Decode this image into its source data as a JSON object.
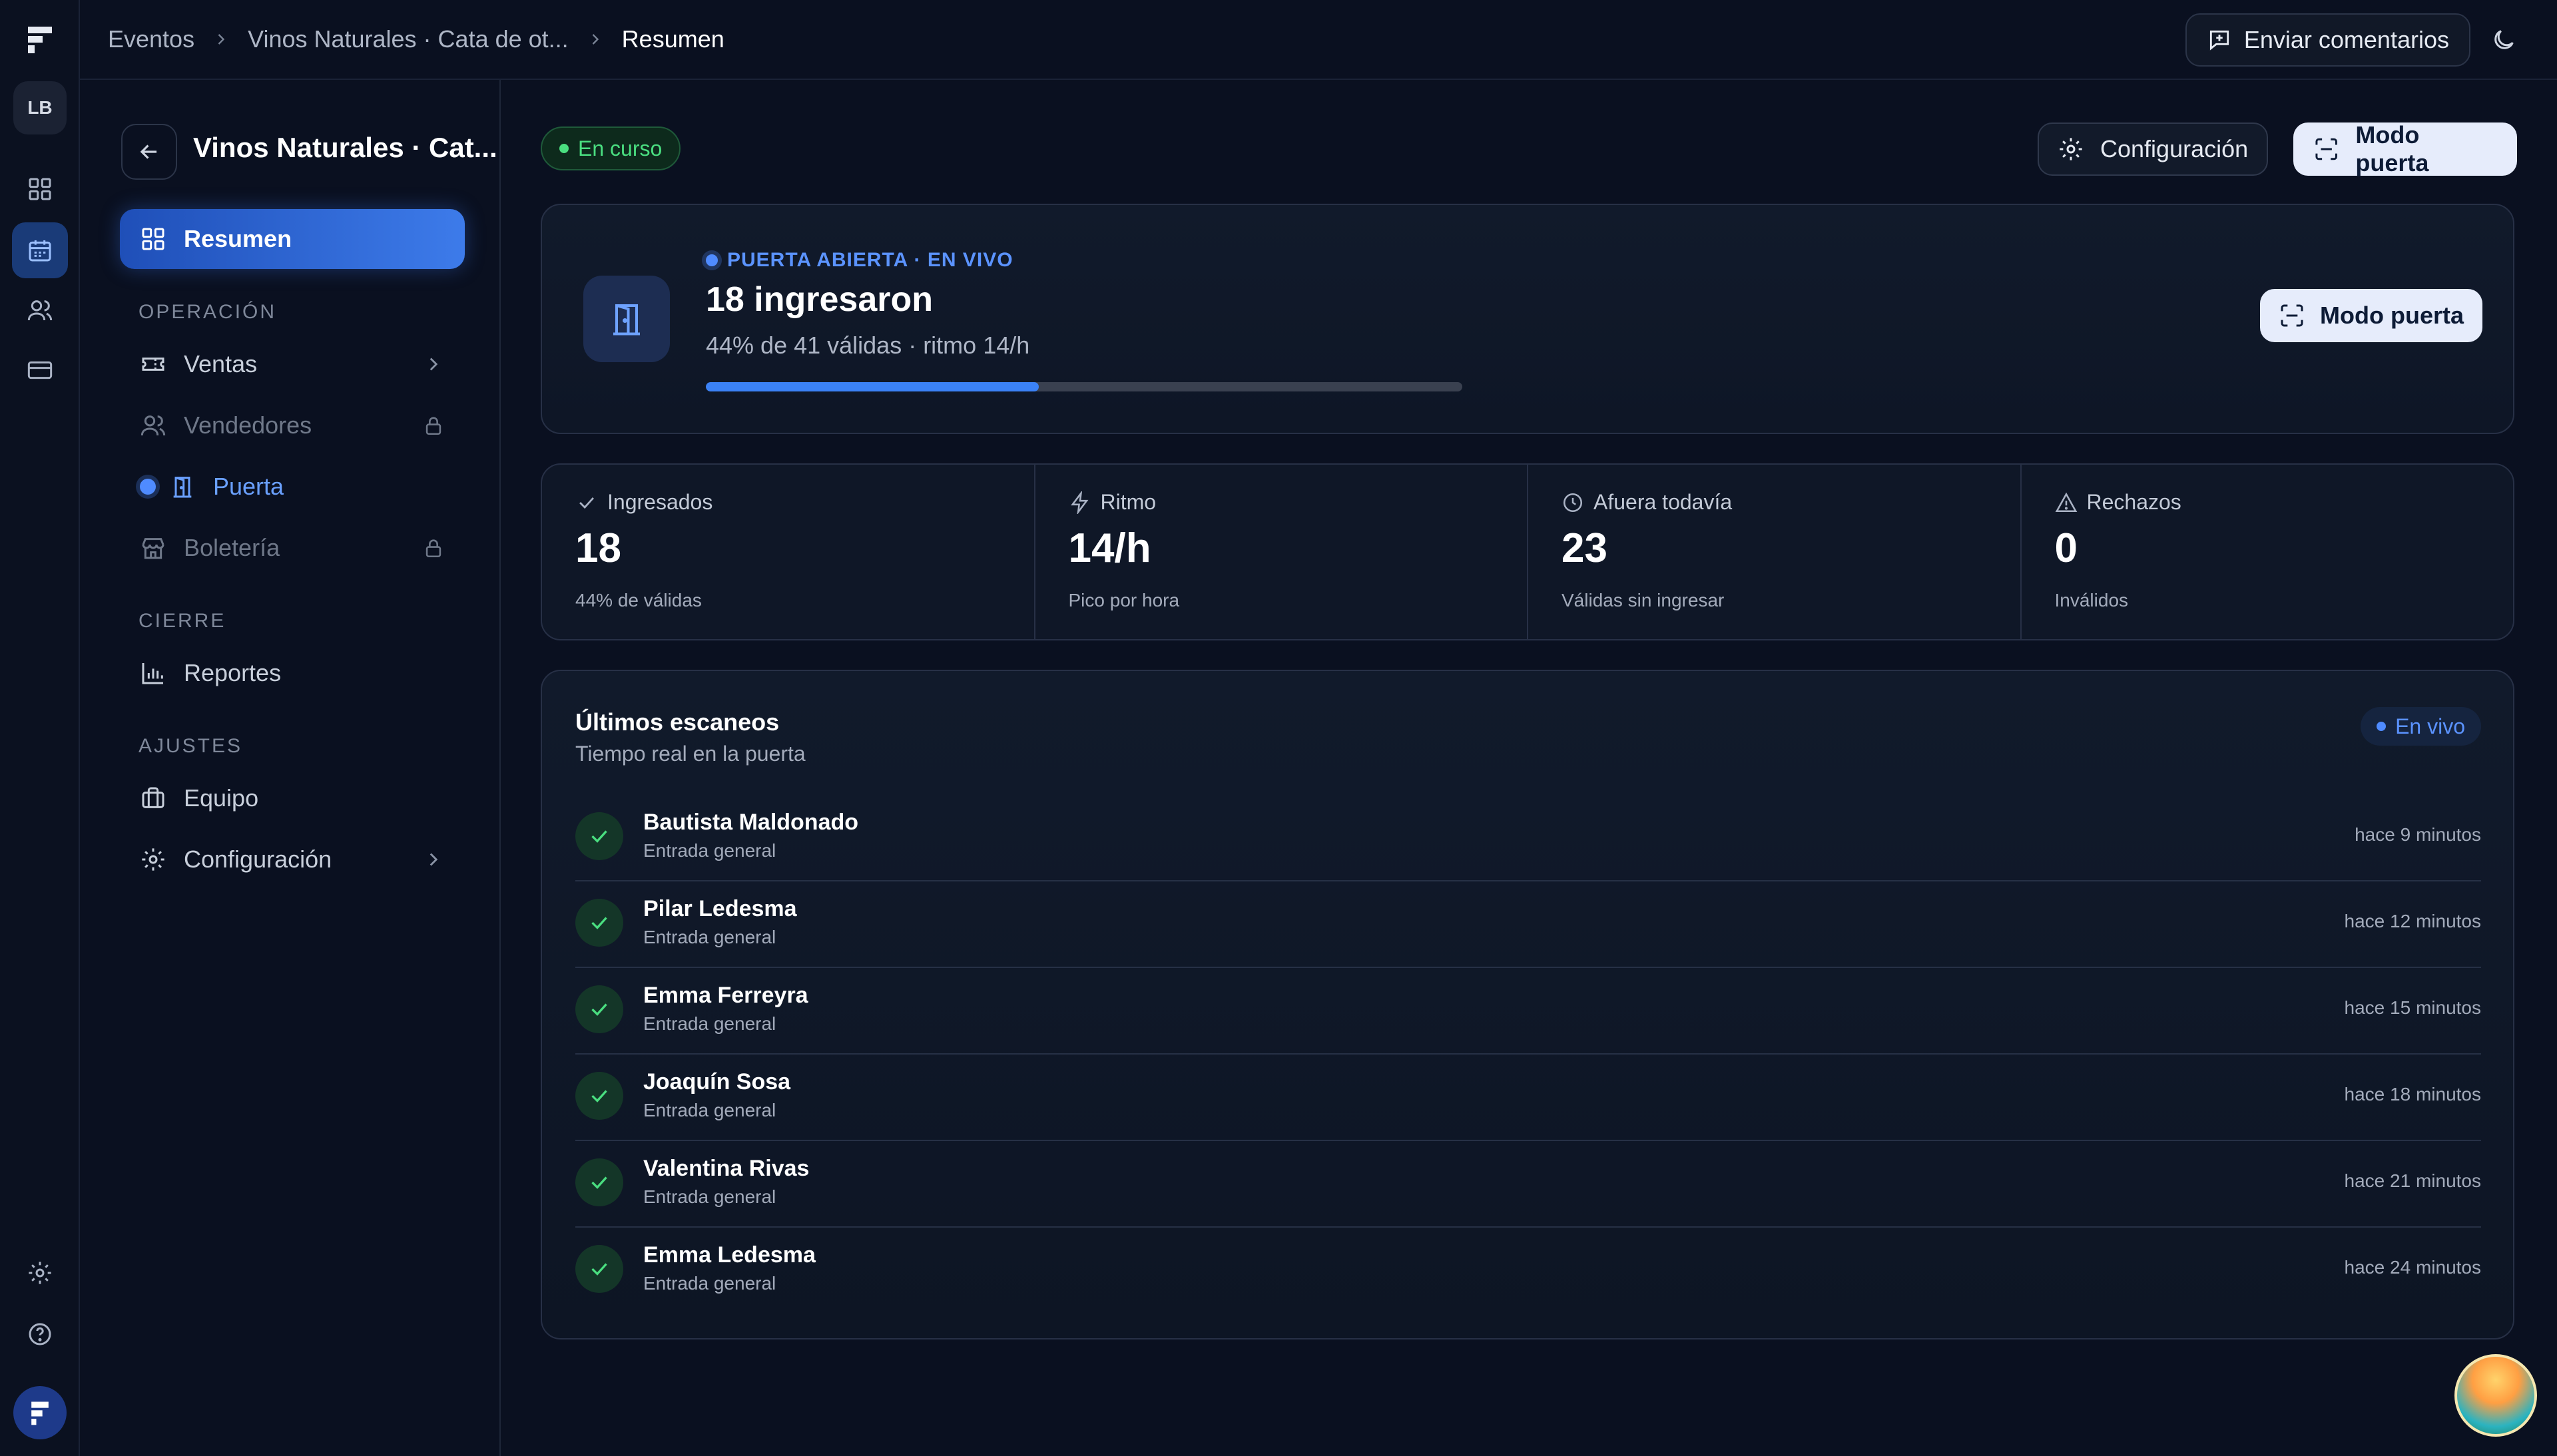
{
  "rail": {
    "avatar": "LB"
  },
  "breadcrumb": [
    "Eventos",
    "Vinos Naturales · Cata de ot...",
    "Resumen"
  ],
  "topbar": {
    "feedback_label": "Enviar comentarios"
  },
  "sidenav": {
    "event_title": "Vinos Naturales · Cat...",
    "items": [
      {
        "label": "Resumen",
        "icon": "grid-icon",
        "state": "active"
      },
      {
        "label": "Ventas",
        "icon": "ticket-icon",
        "state": "normal",
        "trailing": "chevron"
      },
      {
        "label": "Vendedores",
        "icon": "users-icon",
        "state": "locked",
        "trailing": "lock"
      },
      {
        "label": "Puerta",
        "icon": "door-icon",
        "state": "current"
      },
      {
        "label": "Boletería",
        "icon": "store-icon",
        "state": "locked",
        "trailing": "lock"
      },
      {
        "label": "Reportes",
        "icon": "bar-chart-icon",
        "state": "normal"
      },
      {
        "label": "Equipo",
        "icon": "briefcase-icon",
        "state": "normal"
      },
      {
        "label": "Configuración",
        "icon": "gear-icon",
        "state": "normal",
        "trailing": "chevron"
      }
    ],
    "sections": [
      "OPERACIÓN",
      "CIERRE",
      "AJUSTES"
    ]
  },
  "main": {
    "status_badge": "En curso",
    "config_label": "Configuración",
    "door_mode_label": "Modo puerta"
  },
  "hero": {
    "status": "PUERTA ABIERTA · EN VIVO",
    "title": "18 ingresaron",
    "subtitle": "44% de 41 válidas · ritmo 14/h",
    "progress_fraction": 0.44,
    "button_label": "Modo puerta"
  },
  "stats": [
    {
      "label": "Ingresados",
      "icon": "check-icon",
      "value": "18",
      "note": "44% de válidas"
    },
    {
      "label": "Ritmo",
      "icon": "zap-icon",
      "value": "14/h",
      "note": "Pico por hora"
    },
    {
      "label": "Afuera todavía",
      "icon": "clock-icon",
      "value": "23",
      "note": "Válidas sin ingresar"
    },
    {
      "label": "Rechazos",
      "icon": "alert-icon",
      "value": "0",
      "note": "Inválidos"
    }
  ],
  "scans": {
    "title": "Últimos escaneos",
    "subtitle": "Tiempo real en la puerta",
    "live_label": "En vivo",
    "rows": [
      {
        "name": "Bautista Maldonado",
        "type": "Entrada general",
        "time": "hace 9 minutos"
      },
      {
        "name": "Pilar Ledesma",
        "type": "Entrada general",
        "time": "hace 12 minutos"
      },
      {
        "name": "Emma Ferreyra",
        "type": "Entrada general",
        "time": "hace 15 minutos"
      },
      {
        "name": "Joaquín Sosa",
        "type": "Entrada general",
        "time": "hace 18 minutos"
      },
      {
        "name": "Valentina Rivas",
        "type": "Entrada general",
        "time": "hace 21 minutos"
      },
      {
        "name": "Emma Ledesma",
        "type": "Entrada general",
        "time": "hace 24 minutos"
      }
    ]
  },
  "colors": {
    "accent": "#3b82f6",
    "success": "#4ade80",
    "background": "#0a1020"
  }
}
